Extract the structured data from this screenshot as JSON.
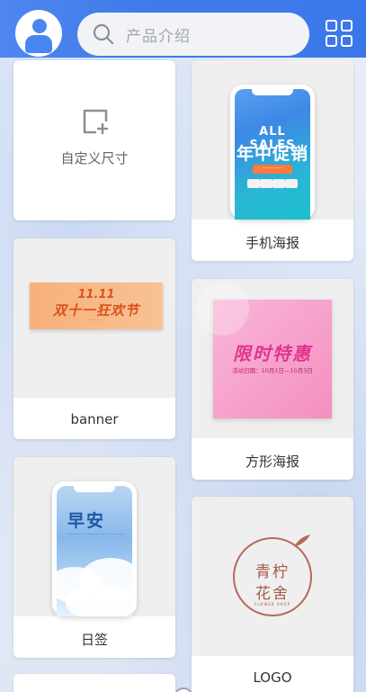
{
  "header": {
    "search_placeholder": "产品介绍"
  },
  "cards": {
    "custom": {
      "label": "自定义尺寸"
    },
    "phone_poster": {
      "label": "手机海报",
      "art_title_en": "ALL SALES",
      "art_title_cn": "年中促销"
    },
    "banner": {
      "label": "banner",
      "art_date": "11.11",
      "art_title": "双十一狂欢节"
    },
    "square_poster": {
      "label": "方形海报",
      "art_title": "限时特惠",
      "art_subtitle": "活动日期：10月1日—10月3日"
    },
    "daily_sign": {
      "label": "日签",
      "art_title": "早安"
    },
    "logo": {
      "label": "LOGO",
      "art_line1": "青柠",
      "art_line2": "花舍",
      "art_line3": "FLOWER SHOP"
    }
  },
  "colors": {
    "header_blue": "#3f7be9",
    "card_bg": "#ffffff",
    "thumb_bg": "#efefef"
  }
}
